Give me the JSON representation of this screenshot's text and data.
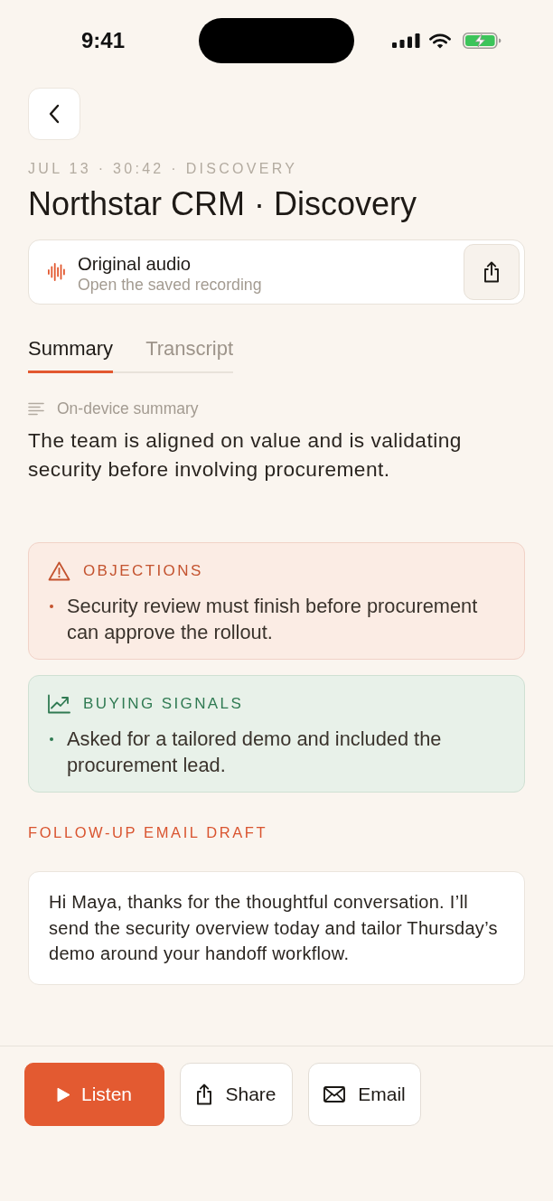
{
  "status_bar": {
    "time": "9:41"
  },
  "header": {
    "meta": "JUL 13 · 30:42 · DISCOVERY",
    "title": "Northstar CRM · Discovery"
  },
  "audio_card": {
    "title": "Original audio",
    "subtitle": "Open the saved recording"
  },
  "tabs": [
    {
      "label": "Summary",
      "selected": true
    },
    {
      "label": "Transcript",
      "selected": false
    }
  ],
  "summary": {
    "label": "On-device summary",
    "text": "The team is aligned on value and is validating security before involving procurement."
  },
  "insights": [
    {
      "kind": "objections",
      "title": "OBJECTIONS",
      "bullets": [
        "Security review must finish before procurement can approve the rollout."
      ]
    },
    {
      "kind": "signals",
      "title": "BUYING SIGNALS",
      "bullets": [
        "Asked for a tailored demo and included the procurement lead."
      ]
    }
  ],
  "email_draft": {
    "label": "FOLLOW-UP EMAIL DRAFT",
    "body": "Hi Maya, thanks for the thoughtful conversation. I’ll send the security overview today and tailor Thursday’s demo around your handoff workflow."
  },
  "actions": [
    {
      "kind": "listen",
      "label": "Listen"
    },
    {
      "kind": "share",
      "label": "Share"
    },
    {
      "kind": "email",
      "label": "Email"
    }
  ]
}
